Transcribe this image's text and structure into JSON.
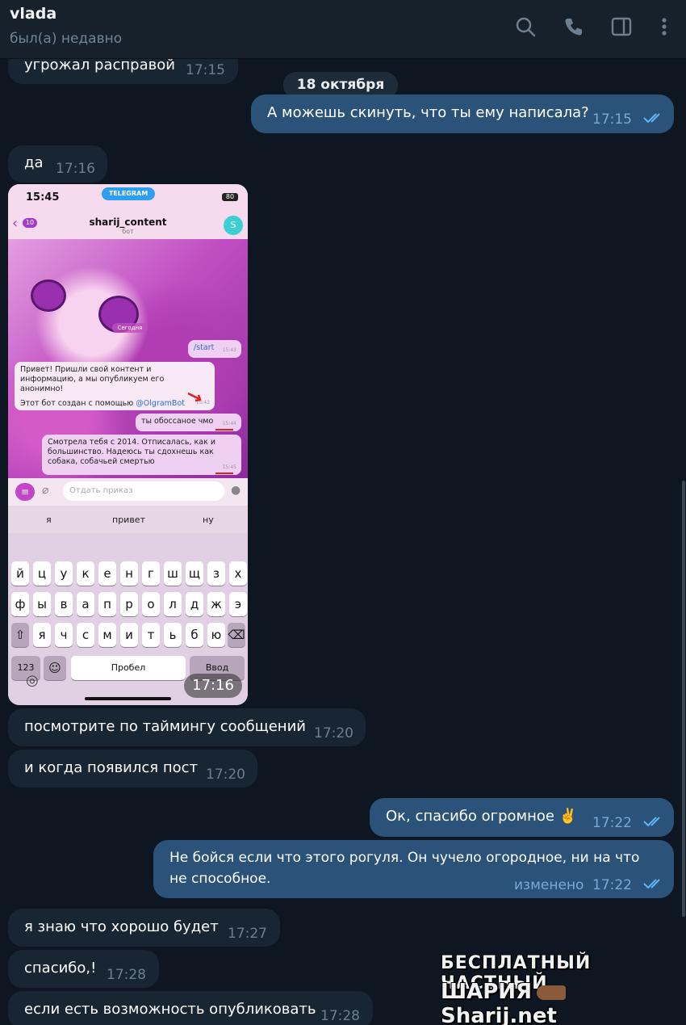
{
  "header": {
    "name": "vlada",
    "status": "был(а) недавно",
    "icons": [
      "search-icon",
      "phone-icon",
      "sidebar-toggle-icon",
      "more-icon"
    ]
  },
  "date_separator": "18 октября",
  "messages": [
    {
      "dir": "in",
      "text": "угрожал расправой",
      "time": "17:15"
    },
    {
      "dir": "out",
      "text": "А можешь скинуть, что ты ему написала?",
      "time": "17:15",
      "read": true
    },
    {
      "dir": "in",
      "text": "да",
      "time": "17:16"
    },
    {
      "dir": "in",
      "type": "photo",
      "time": "17:16"
    },
    {
      "dir": "in",
      "text": "посмотрите по таймингу сообщений",
      "time": "17:20"
    },
    {
      "dir": "in",
      "text": "и когда появился пост",
      "time": "17:20"
    },
    {
      "dir": "out",
      "text": "Ок, спасибо огромное ✌️",
      "time": "17:22",
      "read": true
    },
    {
      "dir": "out",
      "text_line1": "Не бойся если что этого рогуля. Он чучело огородное, ни на что",
      "text_line2": "не способное.",
      "edited": "изменено",
      "time": "17:22",
      "read": true
    },
    {
      "dir": "in",
      "text": "я знаю что хорошо будет",
      "time": "17:27"
    },
    {
      "dir": "in",
      "text": "спасибо,!",
      "time": "17:28"
    },
    {
      "dir": "in",
      "text": "если есть возможность опубликовать",
      "time": "17:28"
    }
  ],
  "photo": {
    "status_time": "15:45",
    "status_pill": "TELEGRAM",
    "battery": "80",
    "back_count": "10",
    "chat_title": "sharij_content",
    "chat_subtitle": "бот",
    "avatar_letter": "S",
    "day_label": "Сегодня",
    "bubble_start": "/start",
    "bubble_start_time": "15:43",
    "bot_text": "Привет! Пришли свой контент и информацию, а мы опубликуем его анонимно!",
    "bot_footer": "Этот бот создан с помощью",
    "bot_link": "@OlgramBot",
    "bot_time": "15:43",
    "sent1": "ты обоссаное чмо",
    "sent1_time": "15:44",
    "sent2": "Смотрела тебя с 2014. Отписалась, как и большинство. Надеюсь ты сдохнешь как собака, собачьей смертью",
    "sent2_time": "15:45",
    "input_placeholder": "Отдать приказ",
    "suggestions": [
      "я",
      "привет",
      "ну"
    ],
    "row1": [
      "й",
      "ц",
      "у",
      "к",
      "е",
      "н",
      "г",
      "ш",
      "щ",
      "з",
      "х"
    ],
    "row2": [
      "ф",
      "ы",
      "в",
      "а",
      "п",
      "р",
      "о",
      "л",
      "д",
      "ж",
      "э"
    ],
    "row3": [
      "я",
      "ч",
      "с",
      "м",
      "и",
      "т",
      "ь",
      "б",
      "ю"
    ],
    "key_123": "123",
    "key_space": "Пробел",
    "key_enter": "Ввод"
  },
  "watermark": {
    "line1": "БЕСПЛАТНЫЙ ЧАСТНЫЙ",
    "line2a": "ШАРИЯ",
    "line2b": "Sharij.net"
  },
  "colors": {
    "background": "#0e1621",
    "header": "#17212b",
    "incoming": "#182533",
    "outgoing": "#2b5278",
    "accent_read": "#5eb5f7"
  }
}
